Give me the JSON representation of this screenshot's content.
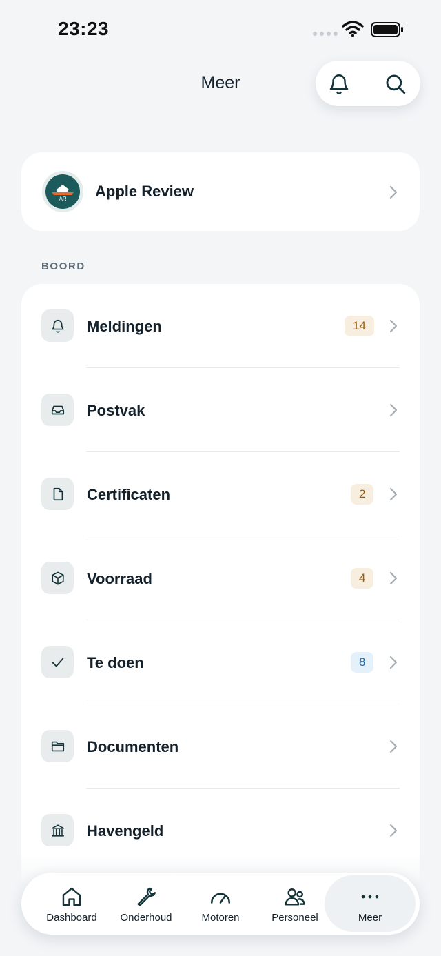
{
  "status_bar": {
    "time": "23:23"
  },
  "header": {
    "title": "Meer"
  },
  "profile": {
    "name": "Apple Review",
    "initials": "AR"
  },
  "section": {
    "label": "BOORD"
  },
  "menu": [
    {
      "label": "Meldingen",
      "icon": "bell-icon",
      "badge": "14",
      "badge_color": "amber"
    },
    {
      "label": "Postvak",
      "icon": "inbox-icon",
      "badge": "",
      "badge_color": ""
    },
    {
      "label": "Certificaten",
      "icon": "document-icon",
      "badge": "2",
      "badge_color": "amber"
    },
    {
      "label": "Voorraad",
      "icon": "package-icon",
      "badge": "4",
      "badge_color": "amber"
    },
    {
      "label": "Te doen",
      "icon": "check-icon",
      "badge": "8",
      "badge_color": "blue"
    },
    {
      "label": "Documenten",
      "icon": "folder-icon",
      "badge": "",
      "badge_color": ""
    },
    {
      "label": "Havengeld",
      "icon": "bank-icon",
      "badge": "",
      "badge_color": ""
    }
  ],
  "tabs": [
    {
      "label": "Dashboard",
      "icon": "home-icon",
      "active": false
    },
    {
      "label": "Onderhoud",
      "icon": "wrench-icon",
      "active": false
    },
    {
      "label": "Motoren",
      "icon": "gauge-icon",
      "active": false
    },
    {
      "label": "Personeel",
      "icon": "users-icon",
      "active": false
    },
    {
      "label": "Meer",
      "icon": "more-icon",
      "active": true
    }
  ],
  "colors": {
    "background": "#f3f5f7",
    "card": "#ffffff",
    "primary": "#1d5a5b",
    "icon_stroke": "#14343a",
    "badge_amber_bg": "#f8eedf",
    "badge_amber_text": "#9b5c09",
    "badge_blue_bg": "#e4f1fb",
    "badge_blue_text": "#1b64a4"
  }
}
